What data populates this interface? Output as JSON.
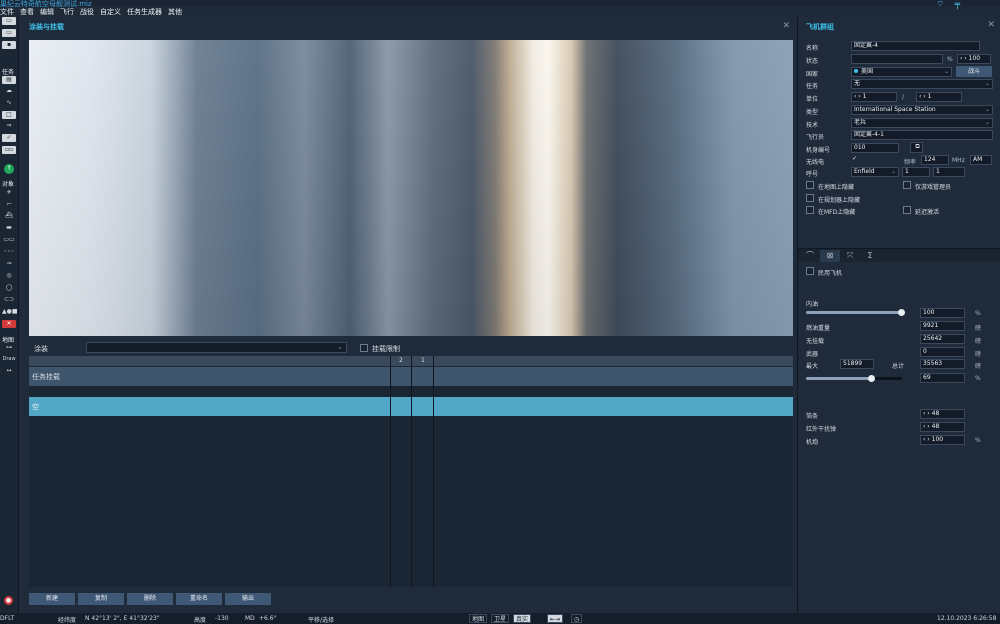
{
  "window": {
    "title": "巢纪云特奇航空母舰测试.miz"
  },
  "menu": [
    "文件",
    "查看",
    "编辑",
    "飞行",
    "战役",
    "自定义",
    "任务生成器",
    "其他"
  ],
  "left_toolbar": {
    "sections": {
      "task": "任务",
      "object": "对象",
      "map": "地图"
    },
    "draw_label": "Draw",
    "icons": [
      "folder-open-icon",
      "folder-icon",
      "save-icon",
      "task-list-icon",
      "cloud-icon",
      "route-icon",
      "square-icon",
      "zone-icon",
      "check-icon",
      "zones-icon",
      "go-icon",
      "aircraft-icon",
      "helicopter-icon",
      "ship-icon",
      "vehicle-icon",
      "static-icon",
      "train-icon",
      "ruler-icon",
      "target-icon",
      "circle-icon",
      "group-icon",
      "shapes-icon",
      "delete-icon",
      "key-icon",
      "measure-icon"
    ]
  },
  "main": {
    "panel_title": "涂装与挂载",
    "skin_label": "涂装",
    "skin_value": "",
    "limit_label": "挂载限制",
    "grid": {
      "columns": [
        "2",
        "1"
      ],
      "task_row": "任务挂载",
      "empty_row": "空"
    },
    "buttons": [
      "新建",
      "复制",
      "删除",
      "重命名",
      "输出"
    ]
  },
  "right": {
    "title": "飞机群组",
    "fields": {
      "name_label": "名称",
      "name_value": "固定翼-4",
      "state_label": "状态",
      "state_value": "",
      "state_pct": "%",
      "state_num": "100",
      "country_label": "国家",
      "country_value": "美国",
      "combat_label": "战斗",
      "task_label": "任务",
      "task_value": "无",
      "unit_label": "单位",
      "unit_value": "1",
      "unit_sep": "/",
      "unit_total": "1",
      "type_label": "类型",
      "type_value": "International Space Station",
      "skill_label": "技术",
      "skill_value": "老兵",
      "pilot_label": "飞行员",
      "pilot_value": "固定翼-4-1",
      "tail_label": "机身编号",
      "tail_value": "010",
      "radio_label": "无线电",
      "freq_label": "频率",
      "freq_value": "124",
      "freq_unit": "MHz",
      "freq_mode": "AM",
      "callsign_label": "呼号",
      "callsign_value": "Enfield",
      "callsign_n1": "1",
      "callsign_n2": "1"
    },
    "checkboxes": {
      "hide_on_map": "在地图上隐藏",
      "game_master_only": "仅游戏管理员",
      "hide_on_planner": "在规划器上隐藏",
      "late_activation": "延迟激活",
      "hide_on_mfd": "在MFD上隐藏"
    },
    "payload": {
      "civil_label": "民用飞机",
      "fuel_label": "内油",
      "fuel_value": "100",
      "fuel_unit": "%",
      "empty_weight_label": "燃油重量",
      "empty_weight_value": "9921",
      "weight_unit": "磅",
      "no_weapons_label": "无挂载",
      "no_weapons_value": "25642",
      "weapons_label": "武器",
      "weapons_value": "0",
      "max_label": "最大",
      "max_value": "51899",
      "total_label": "总计",
      "total_value": "35563",
      "load_pct_value": "69",
      "load_pct_unit": "%",
      "chaff_label": "箔条",
      "chaff_value": "48",
      "flare_label": "红外干扰弹",
      "flare_value": "48",
      "gun_label": "机炮",
      "gun_value": "100",
      "gun_unit": "%"
    },
    "fuel_fraction": 1.0,
    "load_fraction": 0.69
  },
  "status": {
    "dflt": "DFLT",
    "coord_label": "经纬度",
    "coord_value": "N 42°13' 2\", E 41°32'23\"",
    "alt_label": "高度",
    "alt_value": "-130",
    "md_label": "MD",
    "md_value": "+6.6°",
    "mode": "平移/选择",
    "map_modes": [
      "地图",
      "卫星",
      "真实"
    ],
    "datetime": "12.10.2023 6:26:58"
  },
  "colors": {
    "accent": "#3fc0ea",
    "selected_row": "#53a7c6",
    "button": "#3e5875"
  }
}
